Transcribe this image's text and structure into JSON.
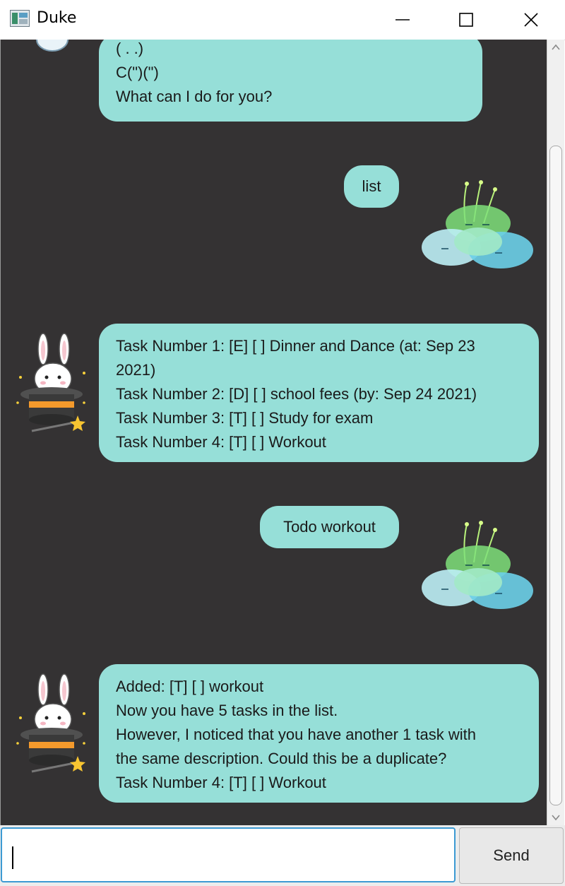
{
  "window": {
    "title": "Duke",
    "app_icon": "duke-app-icon",
    "controls": [
      "minimize-icon",
      "maximize-icon",
      "close-icon"
    ]
  },
  "chat": {
    "messages": [
      {
        "sender": "duke",
        "avatar": "bunny-in-hat-avatar-icon",
        "lines": [
          "( . .)",
          "C(\")(\")",
          "What can I do for you?"
        ]
      },
      {
        "sender": "user",
        "avatar": "glowing-slime-avatar-icon",
        "text": "list"
      },
      {
        "sender": "duke",
        "avatar": "bunny-in-hat-avatar-icon",
        "lines": [
          "Task Number 1: [E] [ ] Dinner and Dance (at: Sep 23",
          "2021)",
          "Task Number 2: [D] [ ] school fees (by: Sep 24 2021)",
          "Task Number 3: [T] [ ] Study for exam",
          "Task Number 4: [T] [ ] Workout"
        ]
      },
      {
        "sender": "user",
        "avatar": "glowing-slime-avatar-icon",
        "text": "Todo workout"
      },
      {
        "sender": "duke",
        "avatar": "bunny-in-hat-avatar-icon",
        "lines": [
          "Added: [T] [ ] workout",
          "Now you have 5 tasks in the list.",
          "However, I noticed that you have another 1 task with",
          "the same description. Could this be a duplicate?",
          "Task Number 4: [T] [ ] Workout"
        ]
      }
    ]
  },
  "input": {
    "value": "",
    "placeholder": ""
  },
  "send_label": "Send",
  "colors": {
    "chat_bg": "#343233",
    "bubble": "#96dfd8",
    "input_focus": "#3c9ad3"
  }
}
